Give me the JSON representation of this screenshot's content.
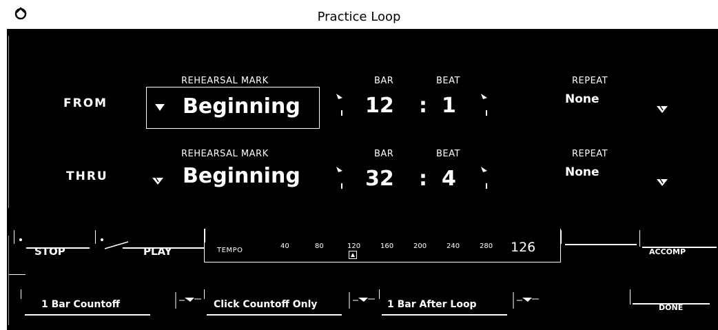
{
  "window": {
    "title": "Practice Loop"
  },
  "from": {
    "label": "FROM",
    "rehearsal_mark_label": "REHEARSAL MARK",
    "rehearsal_mark": "Beginning",
    "bar_label": "BAR",
    "beat_label": "BEAT",
    "bar": "12",
    "separator": ":",
    "beat": "1",
    "repeat_label": "REPEAT",
    "repeat": "None"
  },
  "thru": {
    "label": "THRU",
    "rehearsal_mark_label": "REHEARSAL MARK",
    "rehearsal_mark": "Beginning",
    "bar_label": "BAR",
    "beat_label": "BEAT",
    "bar": "32",
    "separator": ":",
    "beat": "4",
    "repeat_label": "REPEAT",
    "repeat": "None"
  },
  "transport": {
    "stop_label": "STOP",
    "play_label": "PLAY",
    "accomp_label": "ACCOMP"
  },
  "tempo": {
    "label": "TEMPO",
    "ticks": [
      "40",
      "80",
      "120",
      "160",
      "200",
      "240",
      "280"
    ],
    "value": "126"
  },
  "options": {
    "countoff_label": "1 Bar Countoff",
    "click_label": "Click Countoff Only",
    "after_loop_label": "1 Bar After Loop",
    "done_label": "DONE"
  },
  "icons": {
    "app": "app-logo-icon",
    "dropdown": "triangle-down-icon",
    "stepper": "arrow-stepper-icon",
    "checkmark": "check-icon"
  },
  "colors": {
    "panel": "#000000",
    "text": "#ffffff",
    "titlebar": "#ffffff"
  }
}
